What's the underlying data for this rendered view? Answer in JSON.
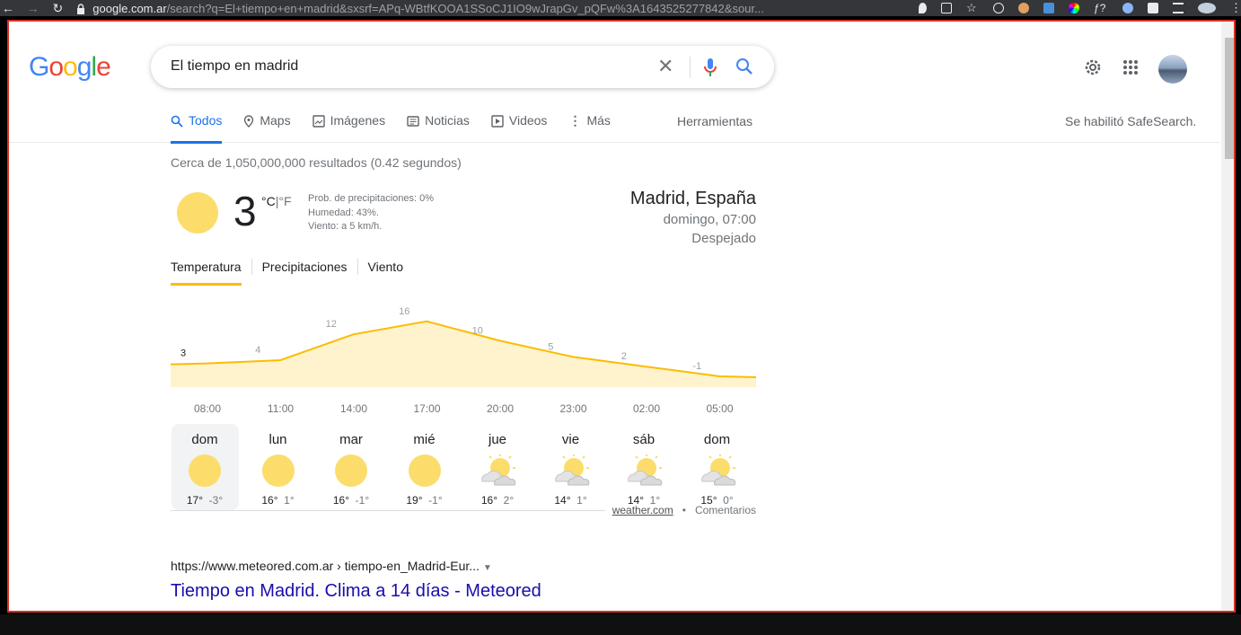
{
  "browser": {
    "url_host": "google.com.ar",
    "url_path": "/search?q=El+tiempo+en+madrid&sxsrf=APq-WBtfKOOA1SSoCJ1IO9wJrapGv_pQFw%3A1643525277842&sour..."
  },
  "search": {
    "query": "El tiempo en madrid"
  },
  "tabs": [
    {
      "label": "Todos",
      "icon": "search-icon"
    },
    {
      "label": "Maps",
      "icon": "map-pin-icon"
    },
    {
      "label": "Imágenes",
      "icon": "image-icon"
    },
    {
      "label": "Noticias",
      "icon": "news-icon"
    },
    {
      "label": "Videos",
      "icon": "play-icon"
    },
    {
      "label": "Más",
      "icon": "more-vert-icon"
    }
  ],
  "tools_label": "Herramientas",
  "safesearch_label": "Se habilitó SafeSearch.",
  "results_count": "Cerca de 1,050,000,000 resultados (0.42 segundos)",
  "weather": {
    "temp": "3",
    "unit_c": "°C",
    "unit_sep": "|",
    "unit_f": "°F",
    "precip": "Prob. de precipitaciones: 0%",
    "humidity": "Humedad: 43%.",
    "wind": "Viento: a 5 km/h.",
    "location": "Madrid, España",
    "datetime": "domingo, 07:00",
    "condition": "Despejado",
    "tabs": [
      "Temperatura",
      "Precipitaciones",
      "Viento"
    ],
    "hours": [
      "08:00",
      "11:00",
      "14:00",
      "17:00",
      "20:00",
      "23:00",
      "02:00",
      "05:00"
    ],
    "days": [
      {
        "name": "dom",
        "hi": "17°",
        "lo": "-3°",
        "icon": "sun-icon"
      },
      {
        "name": "lun",
        "hi": "16°",
        "lo": "1°",
        "icon": "sun-icon"
      },
      {
        "name": "mar",
        "hi": "16°",
        "lo": "-1°",
        "icon": "sun-icon"
      },
      {
        "name": "mié",
        "hi": "19°",
        "lo": "-1°",
        "icon": "sun-icon"
      },
      {
        "name": "jue",
        "hi": "16°",
        "lo": "2°",
        "icon": "partly-cloudy-icon"
      },
      {
        "name": "vie",
        "hi": "14°",
        "lo": "1°",
        "icon": "partly-cloudy-icon"
      },
      {
        "name": "sáb",
        "hi": "14°",
        "lo": "1°",
        "icon": "partly-cloudy-icon"
      },
      {
        "name": "dom",
        "hi": "15°",
        "lo": "0°",
        "icon": "partly-cloudy-icon"
      }
    ],
    "source": "weather.com",
    "feedback": "Comentarios"
  },
  "chart_data": {
    "type": "area",
    "x": [
      "08:00",
      "11:00",
      "14:00",
      "17:00",
      "20:00",
      "23:00",
      "02:00",
      "05:00"
    ],
    "values": [
      3,
      4,
      12,
      16,
      10,
      5,
      2,
      -1
    ],
    "title": "",
    "xlabel": "",
    "ylabel": "",
    "color": "#fbbc04"
  },
  "result1": {
    "url": "https://www.meteored.com.ar › tiempo-en_Madrid-Eur...",
    "title": "Tiempo en Madrid. Clima a 14 días - Meteored"
  }
}
